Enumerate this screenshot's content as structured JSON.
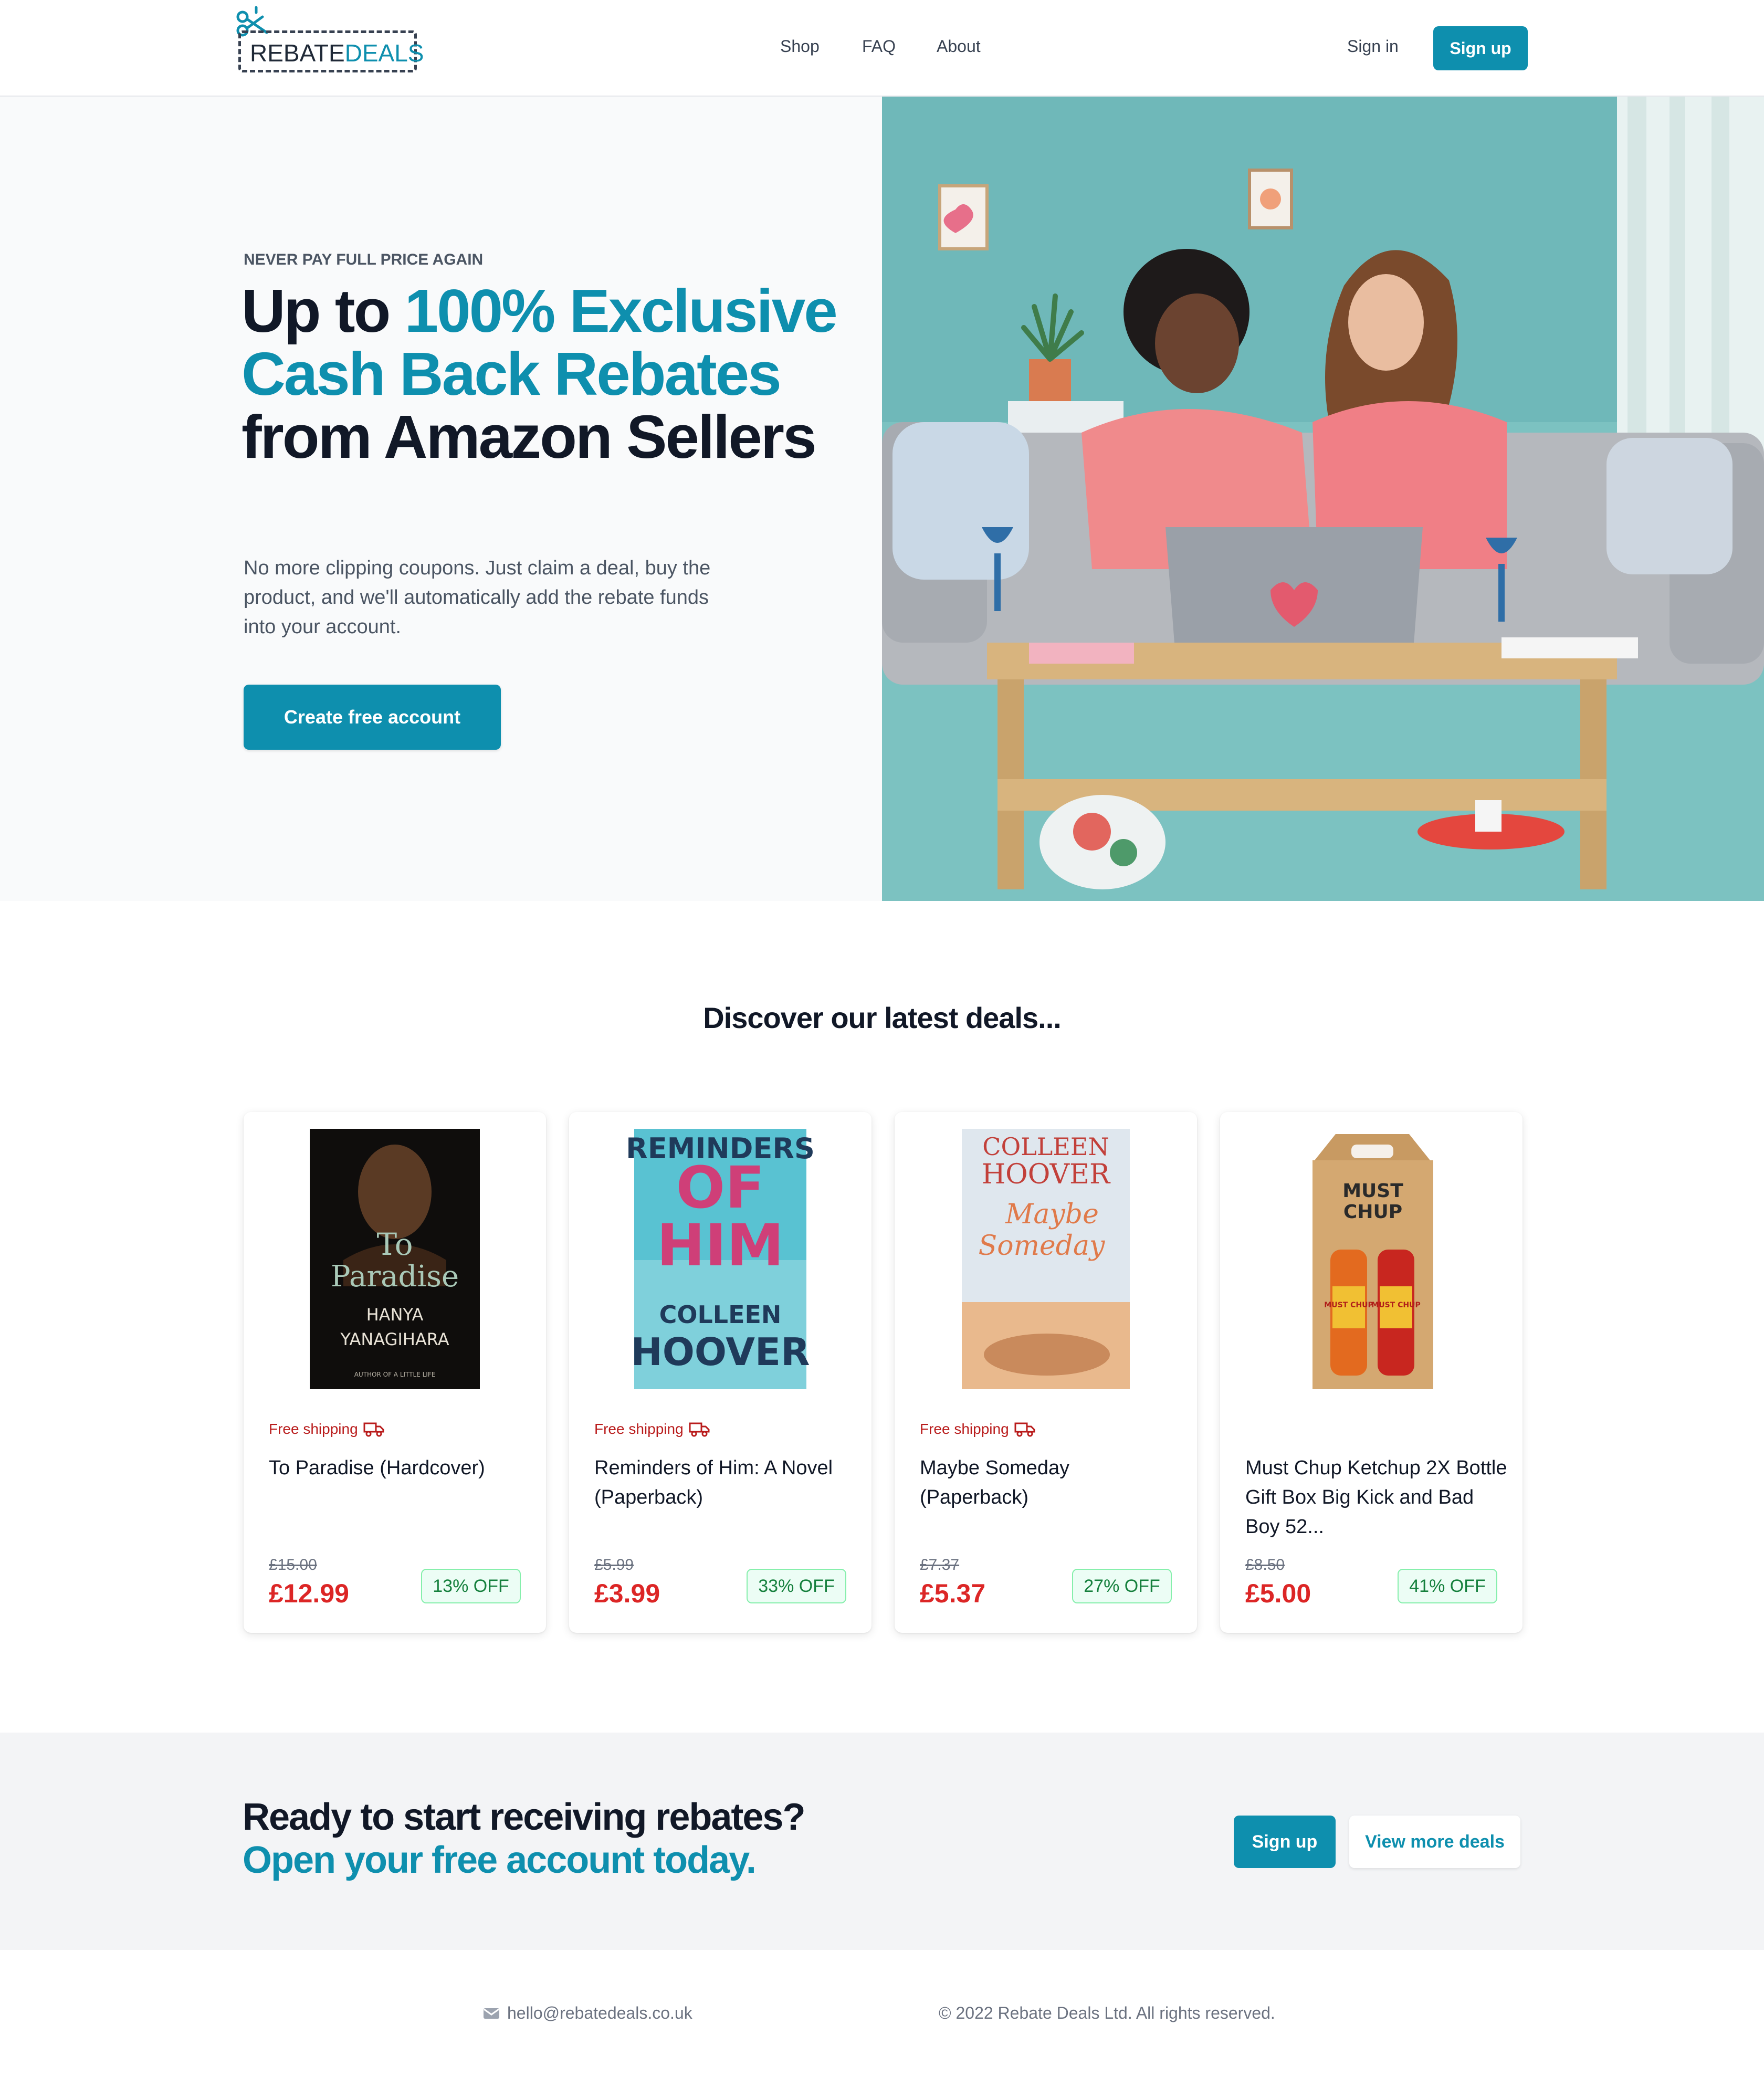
{
  "brand": {
    "part1": "REBATE",
    "part2": "DEALS",
    "accent": "#0e8fae"
  },
  "nav": [
    {
      "label": "Shop"
    },
    {
      "label": "FAQ"
    },
    {
      "label": "About"
    }
  ],
  "header": {
    "signin": "Sign in",
    "signup": "Sign up"
  },
  "hero": {
    "eyebrow": "NEVER PAY FULL PRICE AGAIN",
    "title_a": "Up to ",
    "title_b": "100% Exclusive Cash Back Rebates",
    "title_c": " from Amazon Sellers",
    "description": "No more clipping coupons. Just claim a deal, buy the product, and we'll automatically add the rebate funds into your account.",
    "cta": "Create free account"
  },
  "deals": {
    "heading": "Discover our latest deals...",
    "items": [
      {
        "shipping": "Free shipping",
        "title": "To Paradise (Hardcover)",
        "old_price": "£15.00",
        "price": "£12.99",
        "discount": "13% OFF",
        "cover": {
          "l1": "To",
          "l2": "Paradise",
          "l3": "HANYA",
          "l4": "YANAGIHARA",
          "l5": "AUTHOR OF A LITTLE LIFE"
        }
      },
      {
        "shipping": "Free shipping",
        "title": "Reminders of Him: A Novel (Paperback)",
        "old_price": "£5.99",
        "price": "£3.99",
        "discount": "33% OFF",
        "cover": {
          "l1": "REMINDERS",
          "l2": "OF",
          "l3": "HIM",
          "l4": "COLLEEN",
          "l5": "HOOVER"
        }
      },
      {
        "shipping": "Free shipping",
        "title": "Maybe Someday (Paperback)",
        "old_price": "£7.37",
        "price": "£5.37",
        "discount": "27% OFF",
        "cover": {
          "l1": "COLLEEN",
          "l2": "HOOVER",
          "l3": "Maybe",
          "l4": "Someday"
        }
      },
      {
        "shipping": "",
        "title": "Must Chup Ketchup 2X Bottle Gift Box Big Kick and Bad Boy 52...",
        "old_price": "£8.50",
        "price": "£5.00",
        "discount": "41% OFF",
        "cover": {
          "l1": "MUST",
          "l2": "CHUP",
          "l3": "MUST CHUP",
          "l4": "MUST CHUP"
        }
      }
    ]
  },
  "cta": {
    "line1": "Ready to start receiving rebates?",
    "line2": "Open your free account today.",
    "signup": "Sign up",
    "more": "View more deals"
  },
  "footer": {
    "email": "hello@rebatedeals.co.uk",
    "copyright": "© 2022 Rebate Deals Ltd. All rights reserved."
  }
}
